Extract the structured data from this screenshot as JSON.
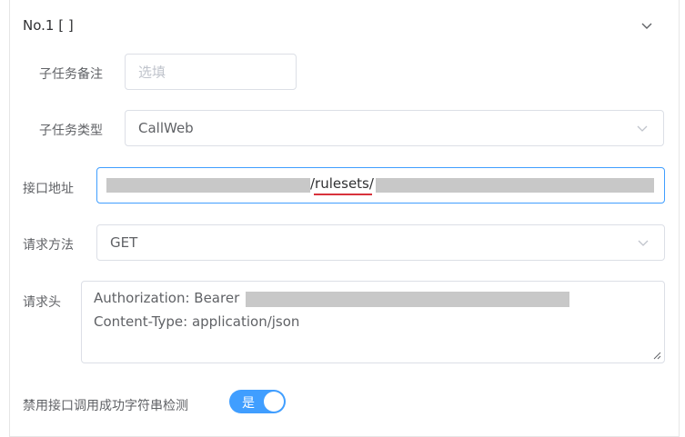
{
  "header": {
    "title": "No.1 [ ]"
  },
  "form": {
    "remark": {
      "label": "子任务备注",
      "placeholder": "选填"
    },
    "type": {
      "label": "子任务类型",
      "value": "CallWeb"
    },
    "url": {
      "label": "接口地址",
      "visible_segment": "/rulesets/"
    },
    "method": {
      "label": "请求方法",
      "value": "GET"
    },
    "headers": {
      "label": "请求头",
      "line1": "Authorization: Bearer",
      "line2": "Content-Type: application/json"
    },
    "disable_check": {
      "label": "禁用接口调用成功字符串检测",
      "switch_text": "是",
      "enabled": true
    }
  },
  "colors": {
    "accent": "#409eff",
    "underline": "#d8323c",
    "redaction": "#c8c8c8"
  },
  "icons": {
    "collapse": "chevron-down-icon",
    "select": "chevron-down-icon",
    "resize": "resize-handle-icon"
  }
}
